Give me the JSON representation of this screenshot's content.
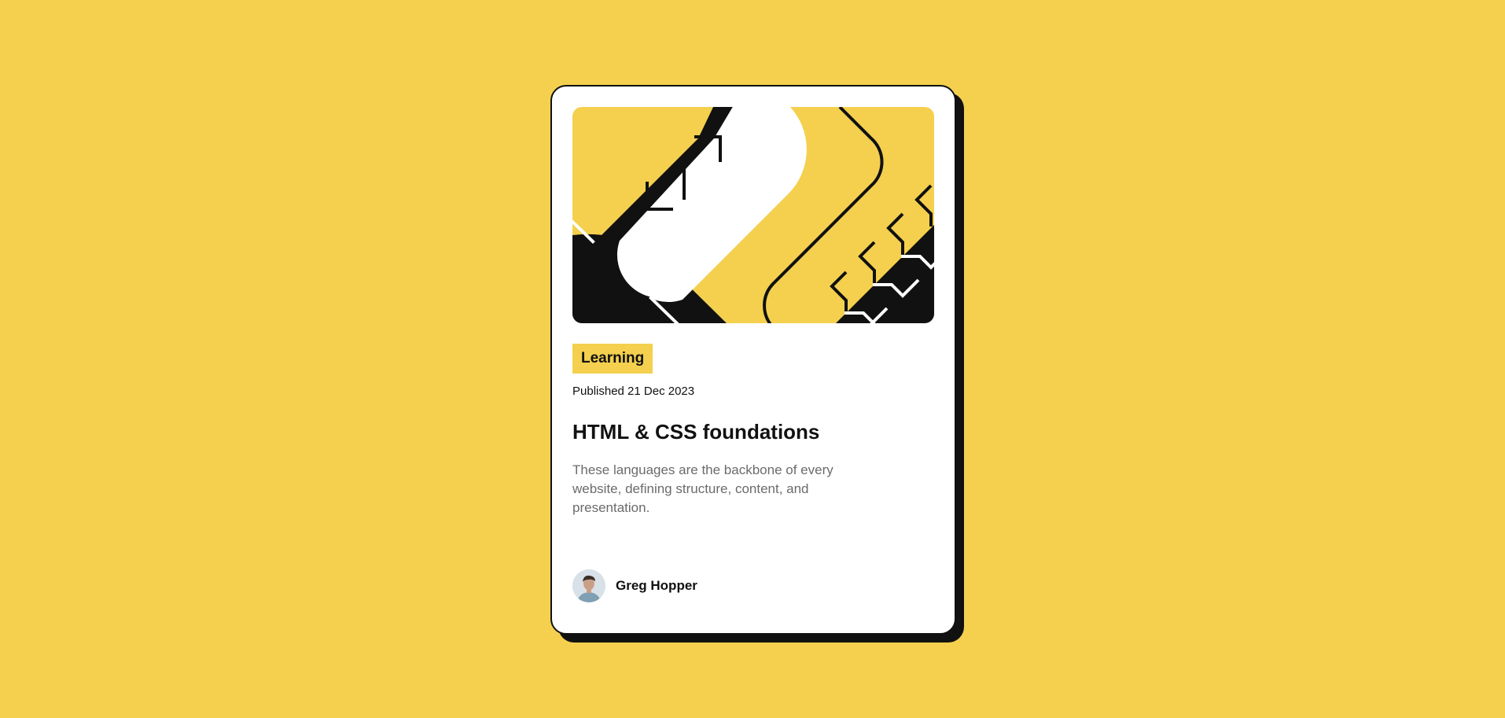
{
  "colors": {
    "background": "#F4D04E",
    "card": "#FFFFFF",
    "ink": "#111111",
    "muted_text": "#6B6B6B"
  },
  "card": {
    "image": "abstract-illustration-icon",
    "tag": "Learning",
    "published": "Published 21 Dec 2023",
    "title": "HTML & CSS foundations",
    "description": "These languages are the backbone of every website, defining structure, content, and presentation."
  },
  "author": {
    "avatar": "avatar-photo-icon",
    "name": "Greg Hopper"
  }
}
